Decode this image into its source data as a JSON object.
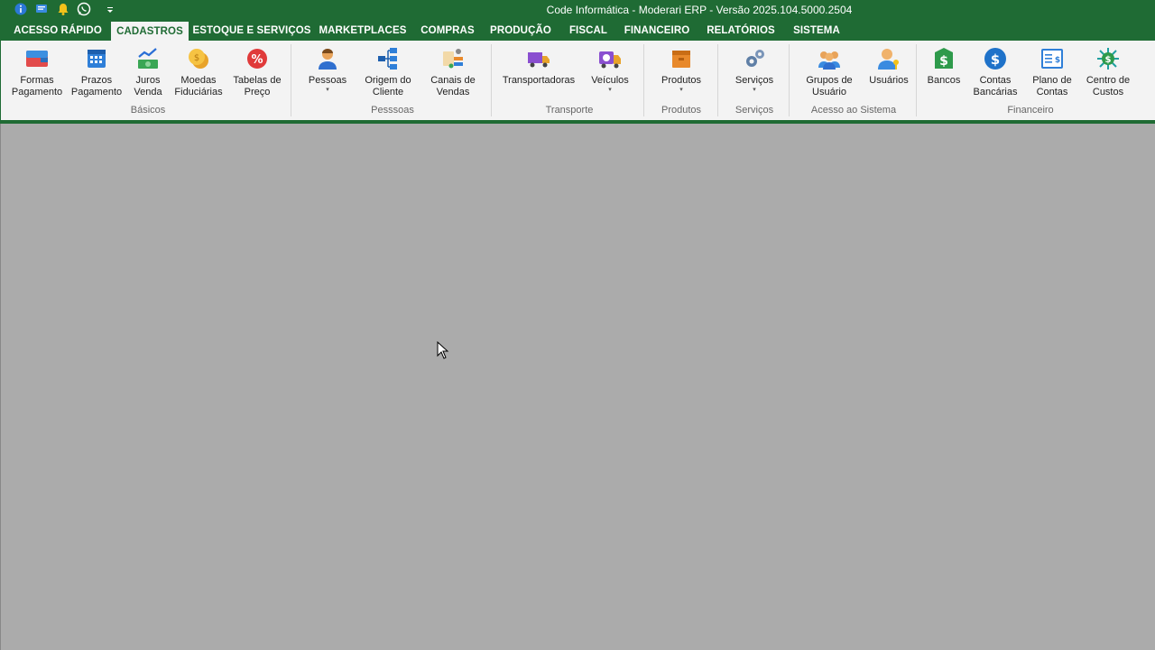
{
  "window": {
    "title": "Code Informática - Moderari ERP - Versão 2025.104.5000.2504"
  },
  "quick_access": [
    "info-icon",
    "chat-icon",
    "bell-icon",
    "whatsapp-icon",
    "customize-icon"
  ],
  "tabs": [
    {
      "label": "ACESSO RÁPIDO",
      "active": false
    },
    {
      "label": "CADASTROS",
      "active": true
    },
    {
      "label": "ESTOQUE E SERVIÇOS",
      "active": false
    },
    {
      "label": "MARKETPLACES",
      "active": false
    },
    {
      "label": "COMPRAS",
      "active": false
    },
    {
      "label": "PRODUÇÃO",
      "active": false
    },
    {
      "label": "FISCAL",
      "active": false
    },
    {
      "label": "FINANCEIRO",
      "active": false
    },
    {
      "label": "RELATÓRIOS",
      "active": false
    },
    {
      "label": "SISTEMA",
      "active": false
    }
  ],
  "ribbon": {
    "groups": {
      "basicos": "Básicos",
      "pessoas": "Pesssoas",
      "transporte": "Transporte",
      "produtos": "Produtos",
      "servicos": "Serviços",
      "acesso": "Acesso ao Sistema",
      "financeiro": "Financeiro"
    },
    "buttons": {
      "formas_pagamento": {
        "line1": "Formas",
        "line2": "Pagamento"
      },
      "prazos_pagamento": {
        "line1": "Prazos",
        "line2": "Pagamento"
      },
      "juros_venda": {
        "line1": "Juros",
        "line2": "Venda"
      },
      "moedas_fiduciarias": {
        "line1": "Moedas",
        "line2": "Fiduciárias"
      },
      "tabelas_preco": {
        "line1": "Tabelas de",
        "line2": "Preço"
      },
      "pessoas": {
        "line1": "Pessoas"
      },
      "origem_cliente": {
        "line1": "Origem do",
        "line2": "Cliente"
      },
      "canais_vendas": {
        "line1": "Canais de",
        "line2": "Vendas"
      },
      "transportadoras": {
        "line1": "Transportadoras"
      },
      "veiculos": {
        "line1": "Veículos"
      },
      "produtos": {
        "line1": "Produtos"
      },
      "servicos": {
        "line1": "Serviços"
      },
      "grupos_usuario": {
        "line1": "Grupos de",
        "line2": "Usuário"
      },
      "usuarios": {
        "line1": "Usuários"
      },
      "bancos": {
        "line1": "Bancos"
      },
      "contas_bancarias": {
        "line1": "Contas",
        "line2": "Bancárias"
      },
      "plano_contas": {
        "line1": "Plano de",
        "line2": "Contas"
      },
      "centro_custos": {
        "line1": "Centro de",
        "line2": "Custos"
      }
    },
    "dropdown_arrow": "▾"
  },
  "colors": {
    "brand": "#1f6b34",
    "ribbon_bg": "#f3f3f3",
    "workspace": "#ababab"
  }
}
